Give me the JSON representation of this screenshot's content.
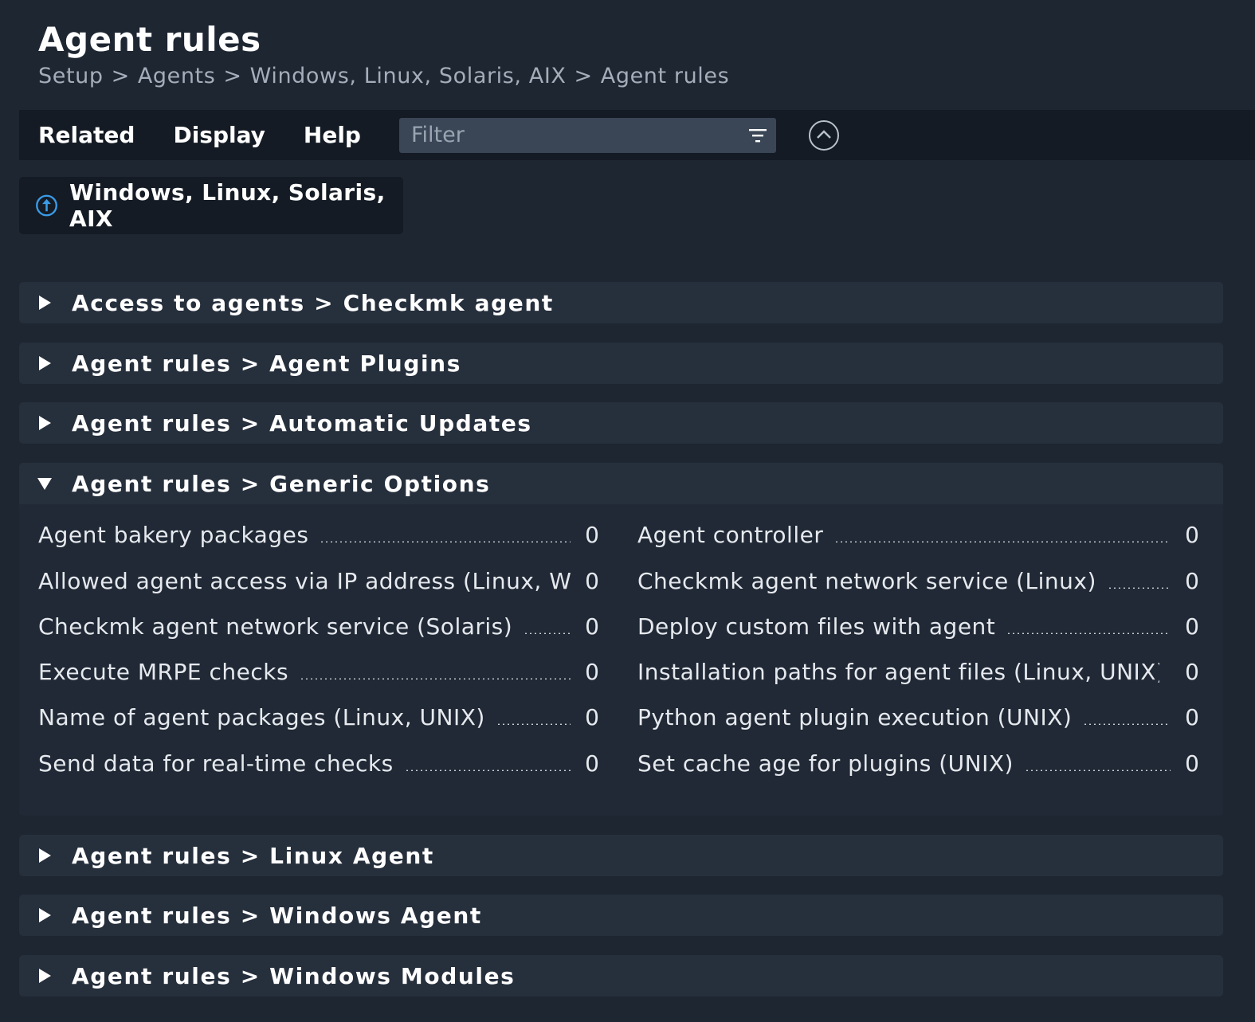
{
  "page": {
    "title": "Agent rules",
    "breadcrumb": [
      "Setup",
      "Agents",
      "Windows, Linux, Solaris, AIX",
      "Agent rules"
    ],
    "breadcrumb_separator": ">"
  },
  "menubar": {
    "items": [
      "Related",
      "Display",
      "Help"
    ],
    "filter_placeholder": "Filter",
    "filter_value": ""
  },
  "back_button": {
    "label": "Windows, Linux, Solaris, AIX"
  },
  "sections": [
    {
      "label": "Access to agents > Checkmk agent",
      "expanded": false
    },
    {
      "label": "Agent rules > Agent Plugins",
      "expanded": false
    },
    {
      "label": "Agent rules > Automatic Updates",
      "expanded": false
    },
    {
      "label": "Agent rules > Generic Options",
      "expanded": true
    },
    {
      "label": "Agent rules > Linux Agent",
      "expanded": false
    },
    {
      "label": "Agent rules > Windows Agent",
      "expanded": false
    },
    {
      "label": "Agent rules > Windows Modules",
      "expanded": false
    }
  ],
  "generic_options_rules": [
    {
      "name": "Agent bakery packages",
      "count": "0"
    },
    {
      "name": "Agent controller",
      "count": "0"
    },
    {
      "name": "Allowed agent access via IP address (Linux, Wind",
      "count": "0"
    },
    {
      "name": "Checkmk agent network service (Linux)",
      "count": "0"
    },
    {
      "name": "Checkmk agent network service (Solaris)",
      "count": "0"
    },
    {
      "name": "Deploy custom files with agent",
      "count": "0"
    },
    {
      "name": "Execute MRPE checks",
      "count": "0"
    },
    {
      "name": "Installation paths for agent files (Linux, UNIX)",
      "count": "0"
    },
    {
      "name": "Name of agent packages (Linux, UNIX)",
      "count": "0"
    },
    {
      "name": "Python agent plugin execution (UNIX)",
      "count": "0"
    },
    {
      "name": "Send data for real-time checks",
      "count": "0"
    },
    {
      "name": "Set cache age for plugins (UNIX)",
      "count": "0"
    }
  ],
  "colors": {
    "background": "#1e2632",
    "menubar": "#141b24",
    "section": "#262f3c",
    "accent_blue": "#3a9be8"
  }
}
